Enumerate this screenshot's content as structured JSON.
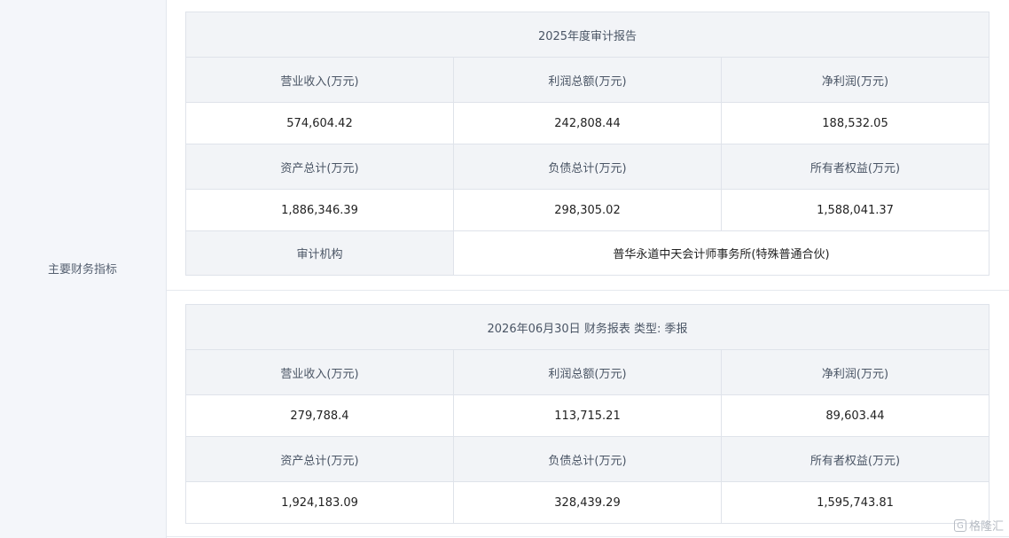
{
  "sidebar": {
    "label": "主要财务指标"
  },
  "annual": {
    "title": "2025年度审计报告",
    "headers1": [
      "营业收入(万元)",
      "利润总额(万元)",
      "净利润(万元)"
    ],
    "values1": [
      "574,604.42",
      "242,808.44",
      "188,532.05"
    ],
    "headers2": [
      "资产总计(万元)",
      "负债总计(万元)",
      "所有者权益(万元)"
    ],
    "values2": [
      "1,886,346.39",
      "298,305.02",
      "1,588,041.37"
    ],
    "auditor_label": "审计机构",
    "auditor_value": "普华永道中天会计师事务所(特殊普通合伙)"
  },
  "quarterly": {
    "title": "2026年06月30日 财务报表 类型: 季报",
    "headers1": [
      "营业收入(万元)",
      "利润总额(万元)",
      "净利润(万元)"
    ],
    "values1": [
      "279,788.4",
      "113,715.21",
      "89,603.44"
    ],
    "headers2": [
      "资产总计(万元)",
      "负债总计(万元)",
      "所有者权益(万元)"
    ],
    "values2": [
      "1,924,183.09",
      "328,439.29",
      "1,595,743.81"
    ]
  },
  "watermark": {
    "icon": "G",
    "text": "格隆汇"
  }
}
